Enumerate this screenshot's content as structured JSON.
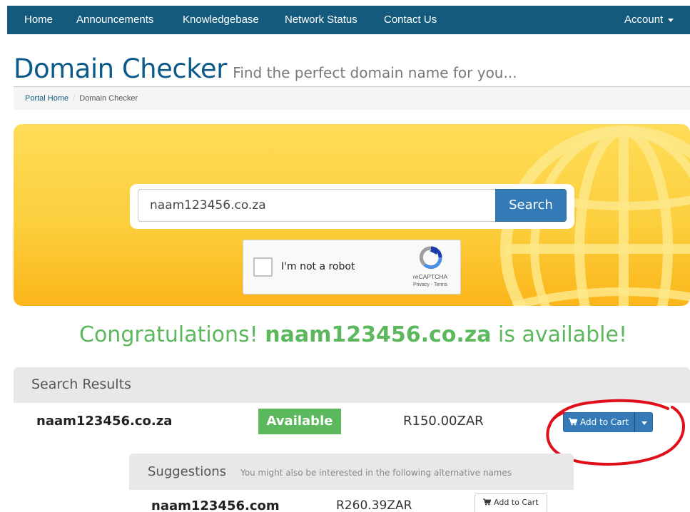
{
  "nav": {
    "items": [
      "Home",
      "Announcements",
      "Knowledgebase",
      "Network Status",
      "Contact Us"
    ],
    "account_label": "Account"
  },
  "header": {
    "title": "Domain Checker",
    "subtitle": "Find the perfect domain name for you..."
  },
  "breadcrumb": {
    "home": "Portal Home",
    "separator": "/",
    "current": "Domain Checker"
  },
  "search": {
    "value": "naam123456.co.za",
    "button_label": "Search"
  },
  "captcha": {
    "label": "I'm not a robot",
    "brand": "reCAPTCHA",
    "terms": "Privacy - Terms"
  },
  "congrats": {
    "prefix": "Congratulations!",
    "domain": "naam123456.co.za",
    "suffix": "is available!"
  },
  "results": {
    "heading": "Search Results",
    "domain": "naam123456.co.za",
    "status": "Available",
    "price": "R150.00ZAR",
    "add_to_cart": "Add to Cart"
  },
  "suggestions": {
    "heading": "Suggestions",
    "subheading": "You might also be interested in the following alternative names",
    "items": [
      {
        "domain": "naam123456.com",
        "price": "R260.39ZAR",
        "add_to_cart": "Add to Cart"
      }
    ]
  },
  "colors": {
    "nav_bg": "#135a7c",
    "title": "#0c5b8a",
    "primary_button": "#337ab7",
    "success": "#5cb85c",
    "banner": "#fccf3d",
    "annotation": "#e0101a"
  },
  "icons": [
    "caret-down-icon",
    "globe-icon",
    "recaptcha-logo-icon",
    "cart-icon"
  ]
}
